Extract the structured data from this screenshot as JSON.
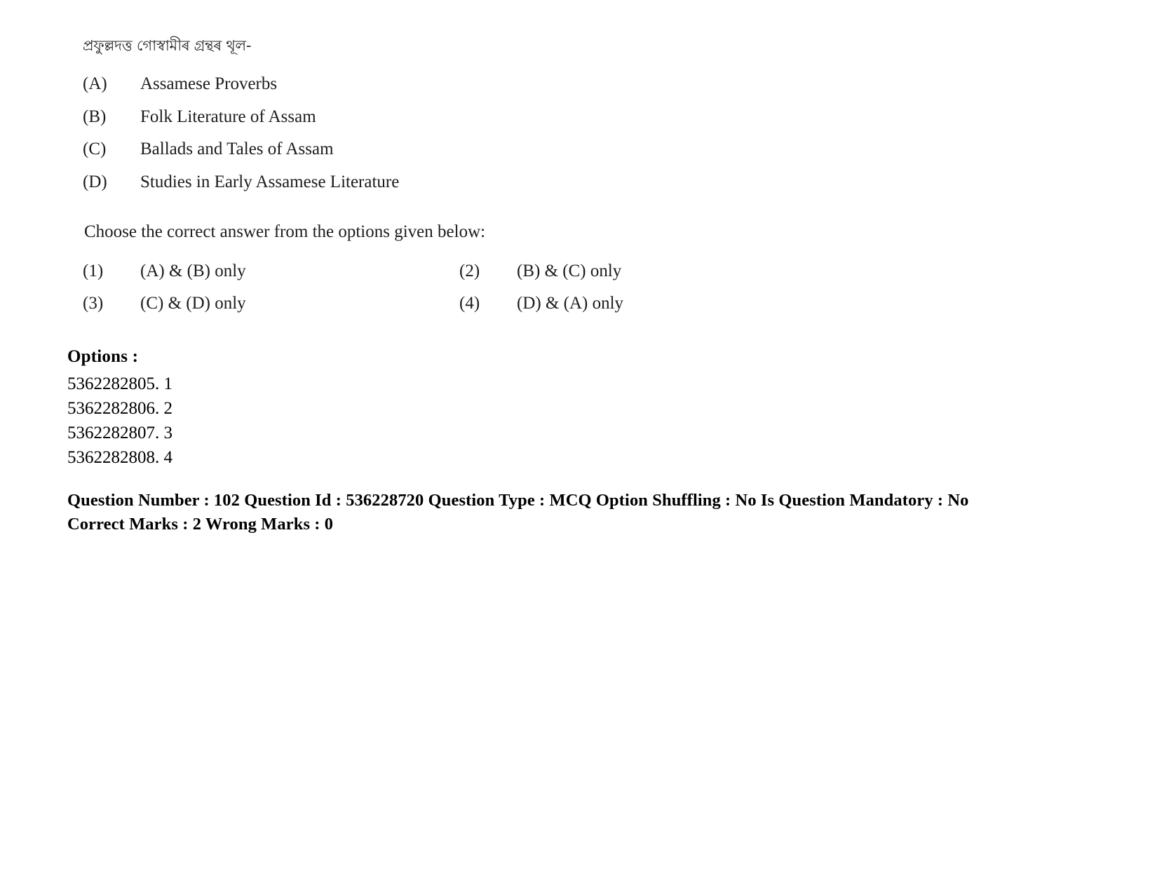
{
  "question_block": {
    "stem_assamese": "প্ৰফুল্লদত্ত গোস্বামীৰ গ্ৰন্থৰ থূল-",
    "statements": [
      {
        "tag": "(A)",
        "text": "Assamese Proverbs"
      },
      {
        "tag": "(B)",
        "text": "Folk Literature of Assam"
      },
      {
        "tag": "(C)",
        "text": "Ballads and Tales of Assam"
      },
      {
        "tag": "(D)",
        "text": "Studies in Early Assamese Literature"
      }
    ],
    "instruction": "Choose the correct answer from the options given below:",
    "choices": [
      {
        "num": "(1)",
        "text": "(A) & (B) only"
      },
      {
        "num": "(2)",
        "text": "(B) & (C) only"
      },
      {
        "num": "(3)",
        "text": "(C) & (D) only"
      },
      {
        "num": "(4)",
        "text": "(D) & (A) only"
      }
    ]
  },
  "options_section": {
    "label": "Options :",
    "items": [
      {
        "id": "5362282805.",
        "value": "1"
      },
      {
        "id": "5362282806.",
        "value": "2"
      },
      {
        "id": "5362282807.",
        "value": "3"
      },
      {
        "id": "5362282808.",
        "value": "4"
      }
    ]
  },
  "metadata": {
    "line1": "Question Number : 102 Question Id : 536228720 Question Type : MCQ Option Shuffling : No Is Question Mandatory : No",
    "line2": "Correct Marks : 2 Wrong Marks : 0",
    "question_number": "102",
    "question_id": "536228720",
    "question_type": "MCQ",
    "option_shuffling": "No",
    "is_question_mandatory": "No",
    "correct_marks": "2",
    "wrong_marks": "0"
  }
}
